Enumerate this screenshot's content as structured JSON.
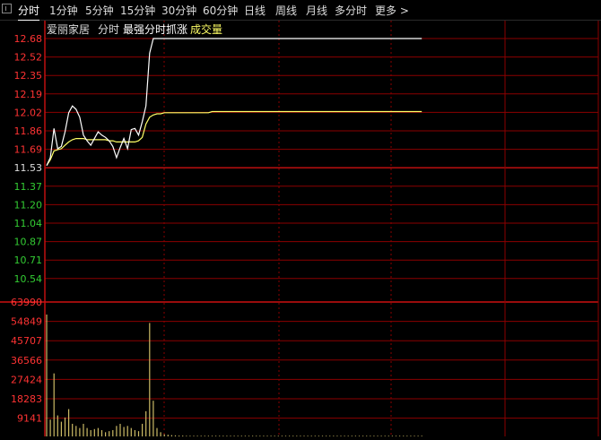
{
  "toolbar": {
    "tabs": [
      {
        "label": "分时",
        "active": true
      },
      {
        "label": "1分钟"
      },
      {
        "label": "5分钟"
      },
      {
        "label": "15分钟"
      },
      {
        "label": "30分钟"
      },
      {
        "label": "60分钟"
      },
      {
        "label": "日线"
      },
      {
        "label": "周线"
      },
      {
        "label": "月线"
      },
      {
        "label": "多分时"
      },
      {
        "label": "更多 >"
      }
    ]
  },
  "header": {
    "stock_name": "爱丽家居",
    "mode": "分时",
    "indicator": "最强分时抓涨",
    "volume_label": "成交量"
  },
  "colors": {
    "grid": "#8b0000",
    "up": "#ff3333",
    "down": "#33cc33",
    "price_line": "#ffffff",
    "avg_line": "#ffff66",
    "volume": "#ccbb66"
  },
  "chart_data": {
    "type": "line",
    "price_axis": {
      "ticks": [
        "12.68",
        "12.52",
        "12.35",
        "12.19",
        "12.02",
        "11.86",
        "11.69",
        "11.53",
        "11.37",
        "11.20",
        "11.04",
        "10.87",
        "10.71",
        "10.54"
      ],
      "base": 11.53,
      "ylim": [
        10.45,
        12.68
      ]
    },
    "volume_axis": {
      "ticks": [
        "63990",
        "54849",
        "45707",
        "36566",
        "27424",
        "18283",
        "9141"
      ],
      "ylim": [
        0,
        63990
      ]
    },
    "price_series": [
      11.55,
      11.62,
      11.88,
      11.7,
      11.72,
      11.85,
      12.02,
      12.08,
      12.05,
      11.98,
      11.82,
      11.77,
      11.73,
      11.79,
      11.85,
      11.82,
      11.8,
      11.77,
      11.72,
      11.62,
      11.71,
      11.79,
      11.7,
      11.87,
      11.88,
      11.82,
      11.94,
      12.08,
      12.55,
      12.68,
      12.68,
      12.68,
      12.68,
      12.68,
      12.68,
      12.68,
      12.68,
      12.68,
      12.68,
      12.68,
      12.68,
      12.68,
      12.68,
      12.68,
      12.68,
      12.68,
      12.68,
      12.68,
      12.68,
      12.68,
      12.68,
      12.68,
      12.68,
      12.68,
      12.68,
      12.68,
      12.68,
      12.68,
      12.68,
      12.68,
      12.68,
      12.68,
      12.68,
      12.68,
      12.68,
      12.68,
      12.68,
      12.68,
      12.68,
      12.68,
      12.68,
      12.68,
      12.68,
      12.68,
      12.68,
      12.68,
      12.68,
      12.68,
      12.68,
      12.68,
      12.68,
      12.68,
      12.68,
      12.68,
      12.68,
      12.68,
      12.68,
      12.68,
      12.68,
      12.68,
      12.68,
      12.68,
      12.68,
      12.68,
      12.68,
      12.68,
      12.68,
      12.68,
      12.68,
      12.68,
      12.68,
      12.68,
      12.68
    ],
    "avg_series": [
      11.55,
      11.6,
      11.68,
      11.69,
      11.7,
      11.73,
      11.76,
      11.78,
      11.79,
      11.79,
      11.79,
      11.78,
      11.78,
      11.78,
      11.78,
      11.78,
      11.78,
      11.77,
      11.77,
      11.76,
      11.76,
      11.76,
      11.76,
      11.76,
      11.76,
      11.77,
      11.8,
      11.92,
      11.98,
      12.0,
      12.01,
      12.01,
      12.02,
      12.02,
      12.02,
      12.02,
      12.02,
      12.02,
      12.02,
      12.02,
      12.02,
      12.02,
      12.02,
      12.02,
      12.02,
      12.03,
      12.03,
      12.03,
      12.03,
      12.03,
      12.03,
      12.03,
      12.03,
      12.03,
      12.03,
      12.03,
      12.03,
      12.03,
      12.03,
      12.03,
      12.03,
      12.03,
      12.03,
      12.03,
      12.03,
      12.03,
      12.03,
      12.03,
      12.03,
      12.03,
      12.03,
      12.03,
      12.03,
      12.03,
      12.03,
      12.03,
      12.03,
      12.03,
      12.03,
      12.03,
      12.03,
      12.03,
      12.03,
      12.03,
      12.03,
      12.03,
      12.03,
      12.03,
      12.03,
      12.03,
      12.03,
      12.03,
      12.03,
      12.03,
      12.03,
      12.03,
      12.03,
      12.03,
      12.03,
      12.03,
      12.03,
      12.03,
      12.03
    ],
    "volume_series": [
      58000,
      8000,
      30000,
      10000,
      7000,
      9000,
      13000,
      6000,
      5000,
      4000,
      6000,
      4000,
      3000,
      3500,
      4000,
      3000,
      2000,
      2500,
      3000,
      5000,
      6000,
      4500,
      5000,
      4000,
      3000,
      2500,
      6000,
      12000,
      54000,
      17000,
      4000,
      2000,
      1000,
      800,
      600,
      500,
      400,
      400,
      300,
      300,
      300,
      300,
      300,
      300,
      300,
      300,
      300,
      300,
      300,
      300,
      300,
      300,
      300,
      300,
      300,
      300,
      300,
      300,
      300,
      300,
      300,
      300,
      300,
      300,
      300,
      300,
      300,
      300,
      300,
      300,
      300,
      300,
      300,
      300,
      300,
      300,
      300,
      300,
      300,
      300,
      300,
      300,
      300,
      300,
      300,
      300,
      300,
      300,
      300,
      300,
      300,
      300,
      300,
      300,
      300,
      300,
      300,
      300,
      300,
      300,
      300,
      300,
      300
    ]
  }
}
